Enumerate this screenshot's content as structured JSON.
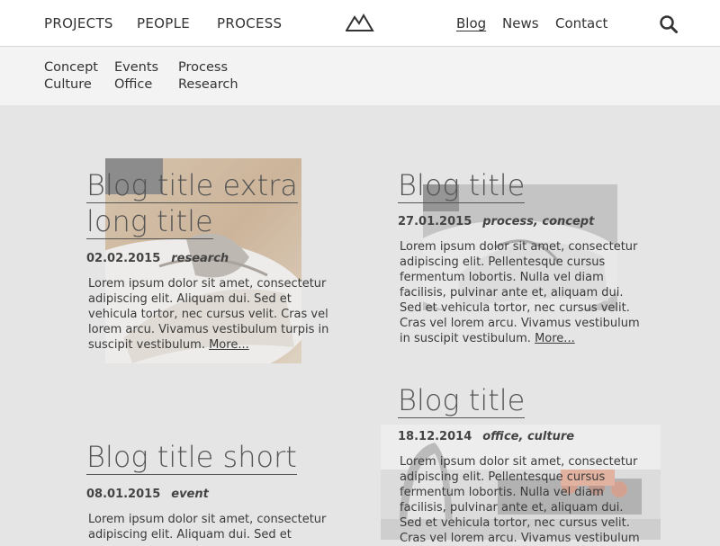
{
  "nav": {
    "left": [
      "PROJECTS",
      "PEOPLE",
      "PROCESS"
    ],
    "right": [
      "Blog",
      "News",
      "Contact"
    ]
  },
  "subnav": {
    "col1": [
      "Concept",
      "Culture"
    ],
    "col2": [
      "Events",
      "Office"
    ],
    "col3": [
      "Process",
      "Research"
    ]
  },
  "posts": [
    {
      "title_line1": "Blog title extra",
      "title_line2": "long title",
      "date": "02.02.2015",
      "tags": "research",
      "excerpt": "Lorem ipsum dolor sit amet, consectetur adipiscing elit. Aliquam dui. Sed et vehicula tortor, nec cursus velit. Cras vel lorem arcu. Vivamus vestibulum turpis in suscipit vestibulum.",
      "more": "More..."
    },
    {
      "title_line1": "Blog title",
      "date": "27.01.2015",
      "tags": "process, concept",
      "excerpt": "Lorem ipsum dolor sit amet, consectetur adipiscing elit. Pellentesque cursus fermentum lobortis. Nulla vel diam facilisis, pulvinar ante et, aliquam dui. Sed et vehicula tortor, nec cursus velit. Cras vel lorem arcu. Vivamus vestibulum in suscipit vestibulum.",
      "more": "More..."
    },
    {
      "title_line1": "Blog title short",
      "date": "08.01.2015",
      "tags": "event",
      "excerpt": "Lorem ipsum dolor sit amet, consectetur adipiscing elit. Aliquam dui. Sed et"
    },
    {
      "title_line1": "Blog title",
      "date": "18.12.2014",
      "tags": "office, culture",
      "excerpt": "Lorem ipsum dolor sit amet, consectetur adipiscing elit. Pellentesque cursus fermentum lobortis. Nulla vel diam facilisis, pulvinar ante et, aliquam dui. Sed et vehicula tortor, nec cursus velit. Cras vel lorem arcu. Vivamus vestibulum"
    }
  ]
}
